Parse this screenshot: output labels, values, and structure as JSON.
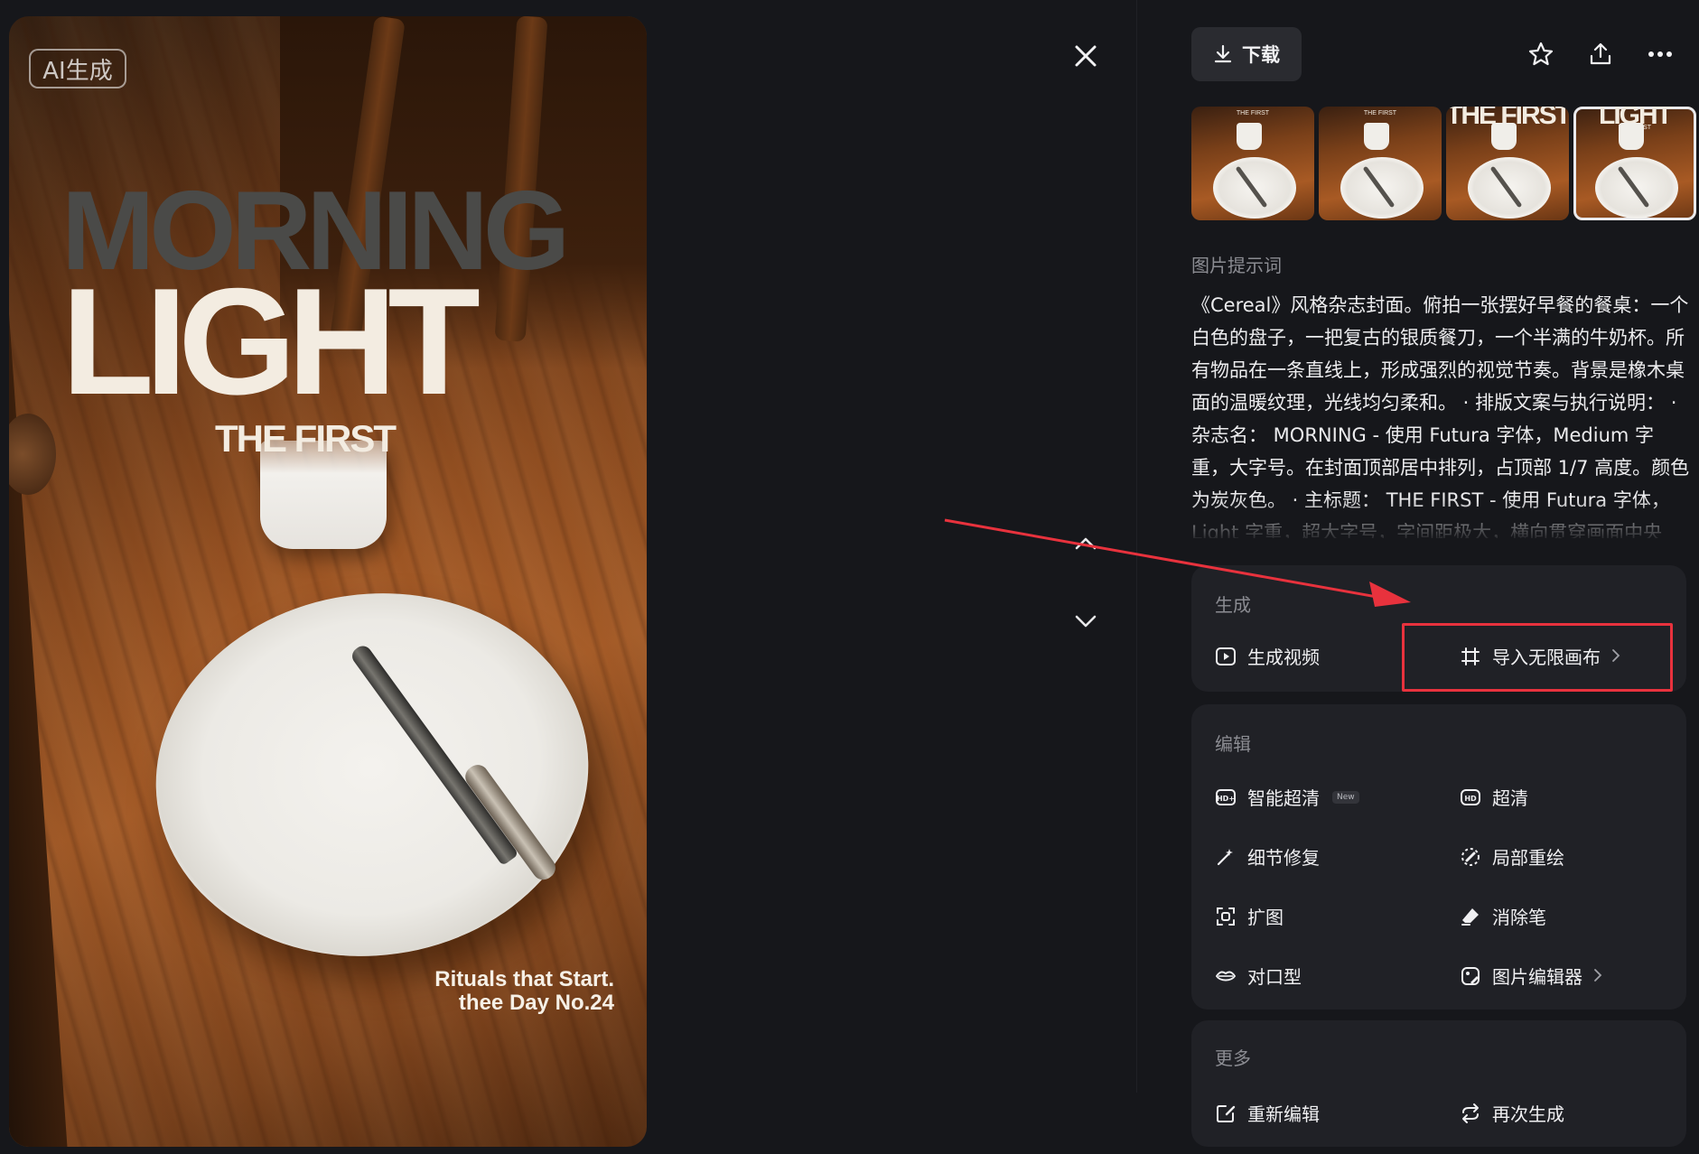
{
  "preview": {
    "ai_badge": "AI生成",
    "mag_morning": "MORNING",
    "mag_light": "LIGHT",
    "mag_first": "THE FIRST",
    "rituals_line1": "Rituals that Start.",
    "rituals_line2": "thee Day No.24"
  },
  "nav": {
    "close_icon": "close-icon",
    "up_icon": "chevron-up-icon",
    "down_icon": "chevron-down-icon"
  },
  "toolbar": {
    "download_label": "下载",
    "favorite_icon": "star-icon",
    "share_icon": "share-icon",
    "more_icon": "more-icon"
  },
  "thumbnails": [
    {
      "title": "",
      "sub": "THE FIRST",
      "selected": false
    },
    {
      "title": "",
      "sub": "THE FIRST",
      "selected": false
    },
    {
      "title": "THE FIRST",
      "sub": "",
      "selected": false
    },
    {
      "title": "LIGHT",
      "sub": "THE FIRST",
      "selected": true
    }
  ],
  "prompt": {
    "label": "图片提示词",
    "text": "《Cereal》风格杂志封面。俯拍一张摆好早餐的餐桌：一个白色的盘子，一把复古的银质餐刀，一个半满的牛奶杯。所有物品在一条直线上，形成强烈的视觉节奏。背景是橡木桌面的温暖纹理，光线均匀柔和。 · 排版文案与执行说明： · 杂志名： MORNING - 使用 Futura 字体，Medium 字重，大字号。在封面顶部居中排列，占顶部 1/7 高度。颜色为炭灰色。 · 主标题： THE FIRST - 使用 Futura 字体，Light 字重，超大字号，字间距极大，横向贯穿画面中央"
  },
  "generate": {
    "title": "生成",
    "video_label": "生成视频",
    "canvas_label": "导入无限画布"
  },
  "edit": {
    "title": "编辑",
    "smart_upscale_label": "智能超清",
    "new_badge": "New",
    "hd_label": "超清",
    "detail_fix_label": "细节修复",
    "inpaint_label": "局部重绘",
    "expand_label": "扩图",
    "eraser_label": "消除笔",
    "lipsync_label": "对口型",
    "image_editor_label": "图片编辑器"
  },
  "more": {
    "title": "更多",
    "re_edit_label": "重新编辑",
    "regenerate_label": "再次生成"
  },
  "colors": {
    "background": "#16171b",
    "card": "#202126",
    "annotation": "#e8323d"
  }
}
